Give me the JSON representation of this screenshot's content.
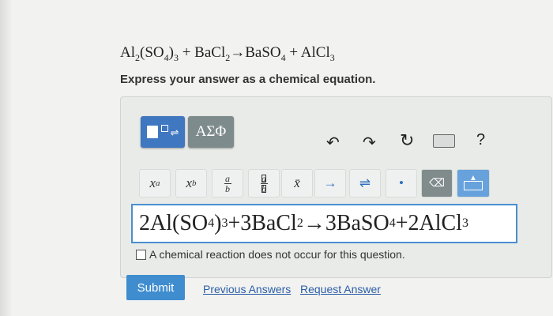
{
  "question": {
    "equation_parts": {
      "p1": "Al",
      "s1": "2",
      "p2": "(SO",
      "s2": "4",
      "p3": ")",
      "s3": "3",
      "p4": " + BaCl",
      "s4": "2",
      "p5": "→BaSO",
      "s5": "4",
      "p6": " + AlCl",
      "s6": "3"
    },
    "instruction": "Express your answer as a chemical equation."
  },
  "toolbar": {
    "symbols_label": "ΑΣΦ",
    "help_label": "?",
    "buttons": {
      "superscript": {
        "base": "x",
        "mark": "a"
      },
      "subscript": {
        "base": "x",
        "mark": "b"
      },
      "fraction": {
        "num": "a",
        "den": "b"
      },
      "boxed_fraction": {
        "num": "a",
        "den": "b"
      },
      "vector": "x̄",
      "arrow": "→",
      "equilibrium": "⇌",
      "dot": "•",
      "delete": "⌫"
    },
    "icons": [
      "templates-icon",
      "undo-icon",
      "redo-icon",
      "reset-icon",
      "keyboard-icon",
      "help-icon"
    ]
  },
  "answer": {
    "parts": {
      "a1": "2Al(SO",
      "b1": "4",
      "a2": ")",
      "b2": "3",
      "a3": " +3BaCl",
      "b3": "2",
      "a4": "→3BaSO",
      "b4": "4",
      "a5": " +2AlCl",
      "b5": "3"
    }
  },
  "no_reaction_label": "A chemical reaction does not occur for this question.",
  "actions": {
    "submit": "Submit",
    "previous_answers": "Previous Answers",
    "request_answer": "Request Answer"
  },
  "colors": {
    "accent": "#3f77c0",
    "submit": "#3f8dcf",
    "field_border": "#4a8fd0",
    "link": "#2a5ea8"
  }
}
